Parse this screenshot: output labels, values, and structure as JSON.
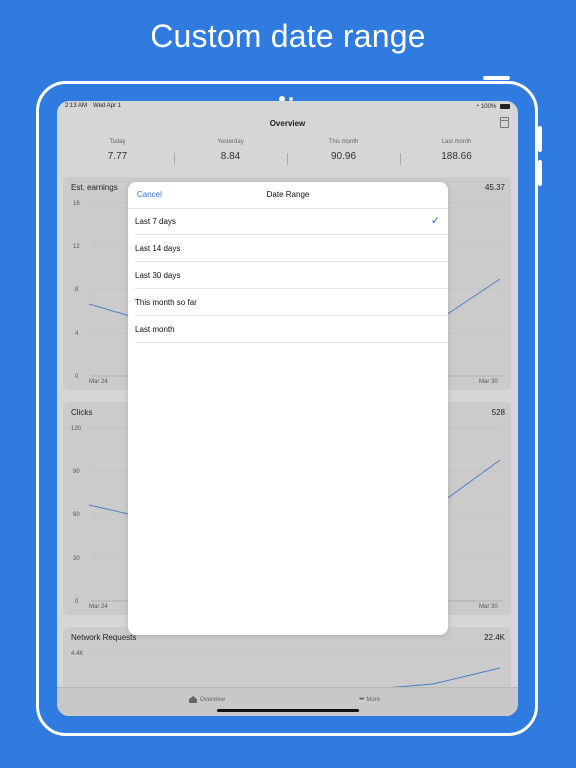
{
  "headline": "Custom date range",
  "status_bar": {
    "time": "2:13 AM",
    "date": "Wed Apr 1",
    "battery": "100%"
  },
  "nav": {
    "title": "Overview",
    "calendar_icon": "calendar-icon"
  },
  "summary": [
    {
      "label": "Today",
      "value": "7.77"
    },
    {
      "label": "Yesterday",
      "value": "8.84"
    },
    {
      "label": "This month",
      "value": "90.96"
    },
    {
      "label": "Last month",
      "value": "188.66"
    }
  ],
  "cards": [
    {
      "title": "Est. earnings",
      "total": "45.37",
      "y_ticks": [
        "16",
        "12",
        "8",
        "4",
        "0"
      ],
      "x_start": "Mar 24",
      "x_end": "Mar 30"
    },
    {
      "title": "Clicks",
      "total": "528",
      "y_ticks": [
        "120",
        "90",
        "60",
        "30",
        "0"
      ],
      "x_start": "Mar 24",
      "x_end": "Mar 30"
    },
    {
      "title": "Network Requests",
      "total": "22.4K",
      "y_ticks": [
        "4.4K"
      ]
    }
  ],
  "tabs": {
    "overview": "Overview",
    "more": "More",
    "more_glyph": "•••"
  },
  "modal": {
    "cancel": "Cancel",
    "title": "Date Range",
    "check_glyph": "✓",
    "options": [
      "Last 7 days",
      "Last 14 days",
      "Last 30 days",
      "This month so far",
      "Last month"
    ],
    "selected_index": 0
  },
  "colors": {
    "background": "#2f7be0",
    "accent": "#2a73d8",
    "line": "#4a7fc7"
  }
}
